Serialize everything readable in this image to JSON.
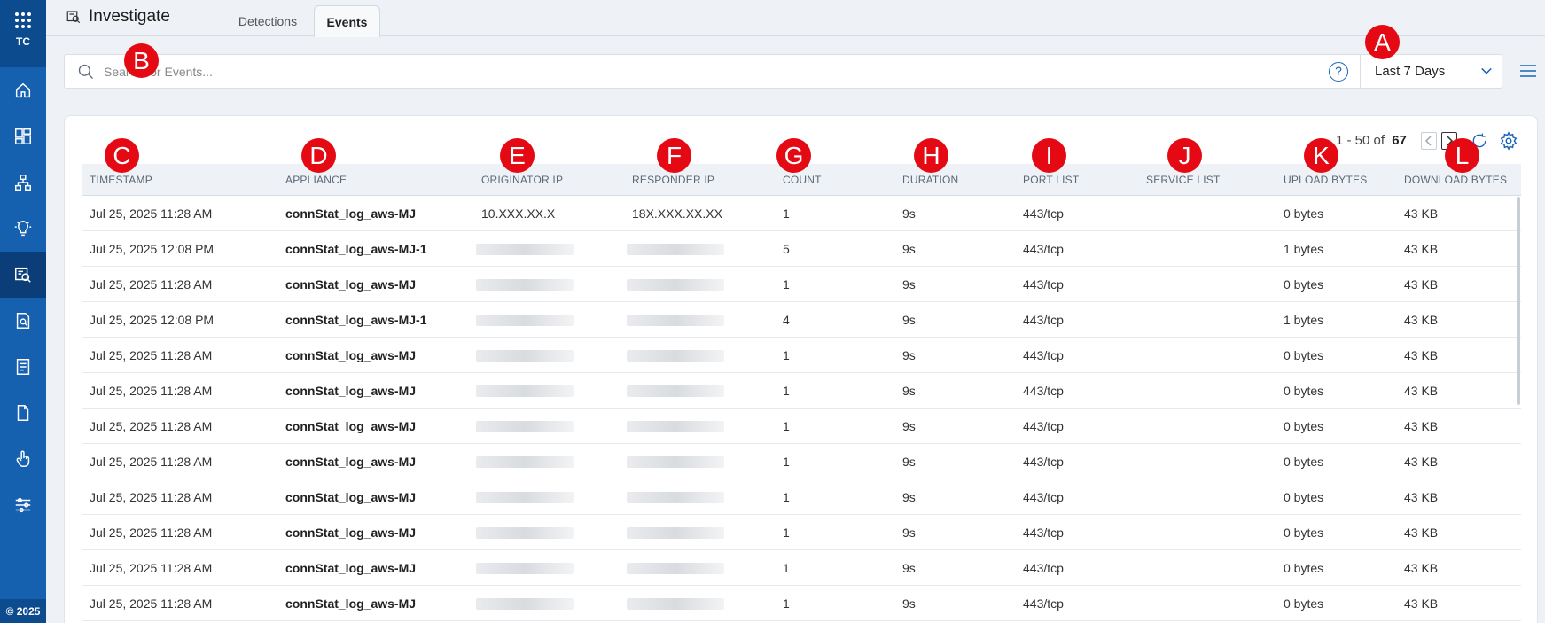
{
  "sidebar": {
    "brand": "TC",
    "footer": "© 2025",
    "items": [
      {
        "icon": "home-icon"
      },
      {
        "icon": "dashboard-icon"
      },
      {
        "icon": "network-icon"
      },
      {
        "icon": "lightbulb-icon"
      },
      {
        "icon": "investigate-icon",
        "active": true
      },
      {
        "icon": "report-search-icon"
      },
      {
        "icon": "list-document-icon"
      },
      {
        "icon": "file-icon"
      },
      {
        "icon": "hand-pointer-icon"
      },
      {
        "icon": "sliders-icon"
      }
    ]
  },
  "header": {
    "title": "Investigate",
    "tabs": [
      {
        "label": "Detections",
        "active": false
      },
      {
        "label": "Events",
        "active": true
      }
    ]
  },
  "search": {
    "placeholder": "Search for Events...",
    "value": "",
    "help": "?",
    "time_range": "Last 7 Days"
  },
  "pager": {
    "range": "1 - 50 of",
    "total": "67"
  },
  "table": {
    "columns": [
      "TIMESTAMP",
      "APPLIANCE",
      "ORIGINATOR IP",
      "RESPONDER IP",
      "COUNT",
      "DURATION",
      "PORT LIST",
      "SERVICE LIST",
      "UPLOAD BYTES",
      "DOWNLOAD BYTES"
    ],
    "rows": [
      {
        "timestamp": "Jul 25, 2025 11:28 AM",
        "appliance": "connStat_log_aws-MJ",
        "orig_ip": "10.XXX.XX.X",
        "resp_ip": "18X.XXX.XX.XX",
        "count": "1",
        "duration": "9s",
        "ports": "443/tcp",
        "services": "",
        "upload": "0 bytes",
        "download": "43 KB"
      },
      {
        "timestamp": "Jul 25, 2025 12:08 PM",
        "appliance": "connStat_log_aws-MJ-1",
        "orig_ip": "",
        "resp_ip": "",
        "count": "5",
        "duration": "9s",
        "ports": "443/tcp",
        "services": "",
        "upload": "1 bytes",
        "download": "43 KB"
      },
      {
        "timestamp": "Jul 25, 2025 11:28 AM",
        "appliance": "connStat_log_aws-MJ",
        "orig_ip": "",
        "resp_ip": "",
        "count": "1",
        "duration": "9s",
        "ports": "443/tcp",
        "services": "",
        "upload": "0 bytes",
        "download": "43 KB"
      },
      {
        "timestamp": "Jul 25, 2025 12:08 PM",
        "appliance": "connStat_log_aws-MJ-1",
        "orig_ip": "",
        "resp_ip": "",
        "count": "4",
        "duration": "9s",
        "ports": "443/tcp",
        "services": "",
        "upload": "1 bytes",
        "download": "43 KB"
      },
      {
        "timestamp": "Jul 25, 2025 11:28 AM",
        "appliance": "connStat_log_aws-MJ",
        "orig_ip": "",
        "resp_ip": "",
        "count": "1",
        "duration": "9s",
        "ports": "443/tcp",
        "services": "",
        "upload": "0 bytes",
        "download": "43 KB"
      },
      {
        "timestamp": "Jul 25, 2025 11:28 AM",
        "appliance": "connStat_log_aws-MJ",
        "orig_ip": "",
        "resp_ip": "",
        "count": "1",
        "duration": "9s",
        "ports": "443/tcp",
        "services": "",
        "upload": "0 bytes",
        "download": "43 KB"
      },
      {
        "timestamp": "Jul 25, 2025 11:28 AM",
        "appliance": "connStat_log_aws-MJ",
        "orig_ip": "",
        "resp_ip": "",
        "count": "1",
        "duration": "9s",
        "ports": "443/tcp",
        "services": "",
        "upload": "0 bytes",
        "download": "43 KB"
      },
      {
        "timestamp": "Jul 25, 2025 11:28 AM",
        "appliance": "connStat_log_aws-MJ",
        "orig_ip": "",
        "resp_ip": "",
        "count": "1",
        "duration": "9s",
        "ports": "443/tcp",
        "services": "",
        "upload": "0 bytes",
        "download": "43 KB"
      },
      {
        "timestamp": "Jul 25, 2025 11:28 AM",
        "appliance": "connStat_log_aws-MJ",
        "orig_ip": "",
        "resp_ip": "",
        "count": "1",
        "duration": "9s",
        "ports": "443/tcp",
        "services": "",
        "upload": "0 bytes",
        "download": "43 KB"
      },
      {
        "timestamp": "Jul 25, 2025 11:28 AM",
        "appliance": "connStat_log_aws-MJ",
        "orig_ip": "",
        "resp_ip": "",
        "count": "1",
        "duration": "9s",
        "ports": "443/tcp",
        "services": "",
        "upload": "0 bytes",
        "download": "43 KB"
      },
      {
        "timestamp": "Jul 25, 2025 11:28 AM",
        "appliance": "connStat_log_aws-MJ",
        "orig_ip": "",
        "resp_ip": "",
        "count": "1",
        "duration": "9s",
        "ports": "443/tcp",
        "services": "",
        "upload": "0 bytes",
        "download": "43 KB"
      },
      {
        "timestamp": "Jul 25, 2025 11:28 AM",
        "appliance": "connStat_log_aws-MJ",
        "orig_ip": "",
        "resp_ip": "",
        "count": "1",
        "duration": "9s",
        "ports": "443/tcp",
        "services": "",
        "upload": "0 bytes",
        "download": "43 KB"
      }
    ]
  },
  "markers": [
    "A",
    "B",
    "C",
    "D",
    "E",
    "F",
    "G",
    "H",
    "I",
    "J",
    "K",
    "L"
  ],
  "colors": {
    "sidebar": "#1660b0",
    "sidebar_top": "#0d4b8f",
    "accent": "#1a65b8",
    "marker": "#e50914"
  }
}
